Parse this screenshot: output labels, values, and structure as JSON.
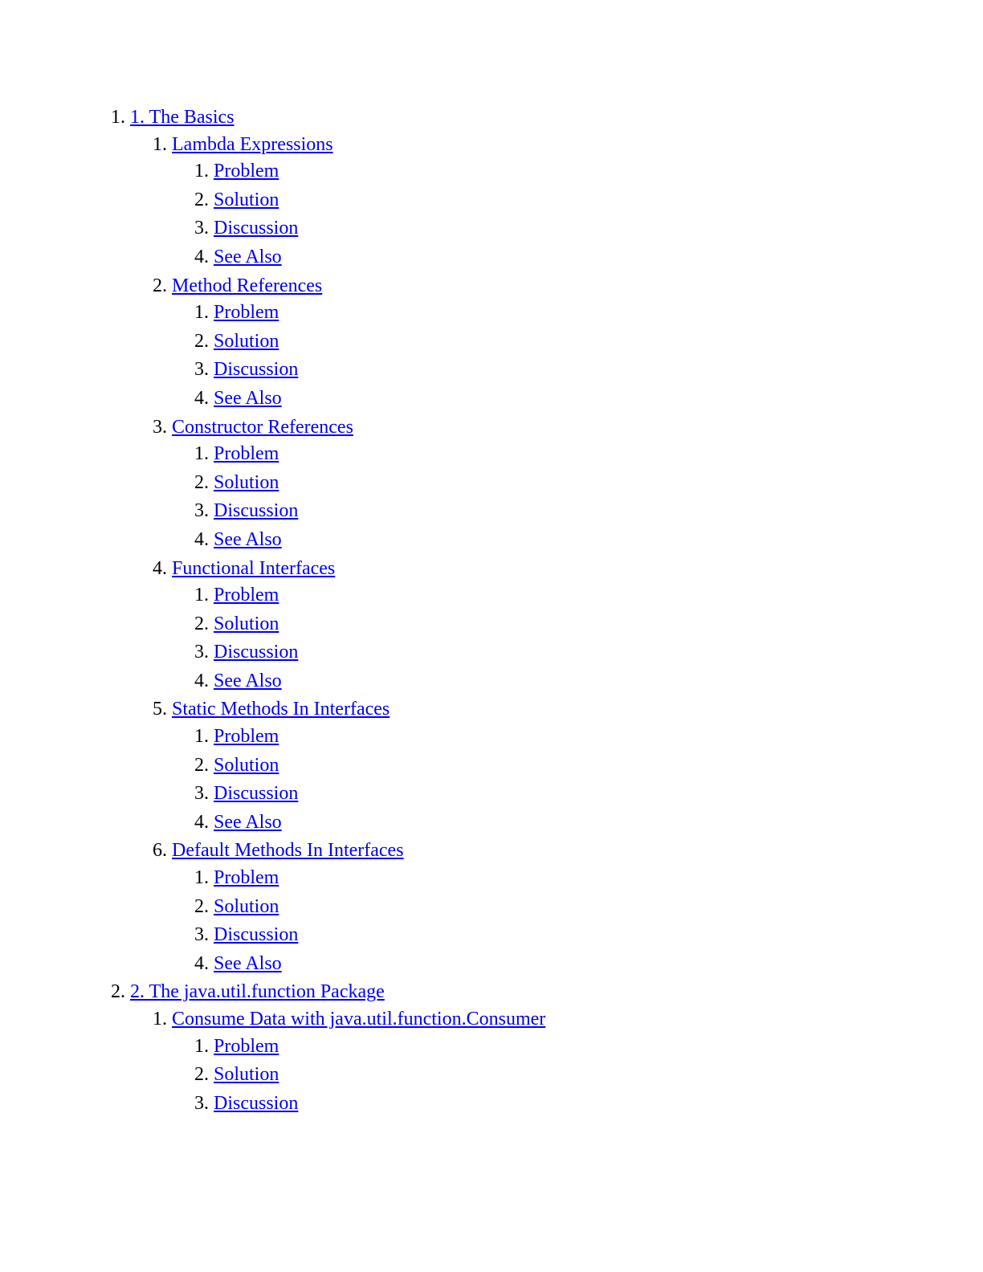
{
  "toc": [
    {
      "title": "1. The Basics",
      "children": [
        {
          "title": "Lambda Expressions",
          "children": [
            {
              "title": "Problem"
            },
            {
              "title": "Solution"
            },
            {
              "title": "Discussion"
            },
            {
              "title": "See Also"
            }
          ]
        },
        {
          "title": "Method References",
          "children": [
            {
              "title": "Problem"
            },
            {
              "title": "Solution"
            },
            {
              "title": "Discussion"
            },
            {
              "title": "See Also"
            }
          ]
        },
        {
          "title": "Constructor References",
          "children": [
            {
              "title": "Problem"
            },
            {
              "title": "Solution"
            },
            {
              "title": "Discussion"
            },
            {
              "title": "See Also"
            }
          ]
        },
        {
          "title": "Functional Interfaces",
          "children": [
            {
              "title": "Problem"
            },
            {
              "title": "Solution"
            },
            {
              "title": "Discussion"
            },
            {
              "title": "See Also"
            }
          ]
        },
        {
          "title": "Static Methods In Interfaces",
          "children": [
            {
              "title": "Problem"
            },
            {
              "title": "Solution"
            },
            {
              "title": "Discussion"
            },
            {
              "title": "See Also"
            }
          ]
        },
        {
          "title": "Default Methods In Interfaces",
          "children": [
            {
              "title": "Problem"
            },
            {
              "title": "Solution"
            },
            {
              "title": "Discussion"
            },
            {
              "title": "See Also"
            }
          ]
        }
      ]
    },
    {
      "title": "2. The java.util.function Package",
      "children": [
        {
          "title": "Consume Data with java.util.function.Consumer",
          "children": [
            {
              "title": "Problem"
            },
            {
              "title": "Solution"
            },
            {
              "title": "Discussion"
            }
          ]
        }
      ]
    }
  ]
}
